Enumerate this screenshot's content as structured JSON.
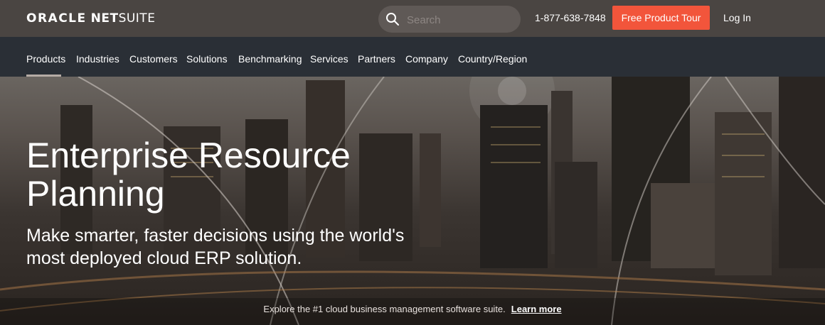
{
  "header": {
    "logo_oracle": "ORACLE",
    "logo_net": "NET",
    "logo_suite": "SUITE",
    "search_placeholder": "Search",
    "phone": "1-877-638-7848",
    "cta_label": "Free Product Tour",
    "login_label": "Log In"
  },
  "nav": {
    "items": [
      "Products",
      "Industries",
      "Customers",
      "Solutions",
      "Benchmarking",
      "Services",
      "Partners",
      "Company",
      "Country/Region"
    ],
    "active": "Products"
  },
  "hero": {
    "title": "Enterprise Resource Planning",
    "subtitle": "Make smarter, faster decisions using the world's most deployed cloud ERP solution.",
    "explore_text": "Explore the #1 cloud business management software suite.",
    "learn_more": "Learn more"
  },
  "colors": {
    "topbar": "#4a4542",
    "nav": "#2a2f36",
    "cta": "#f2553b"
  },
  "icons": {
    "search": "search-icon"
  }
}
